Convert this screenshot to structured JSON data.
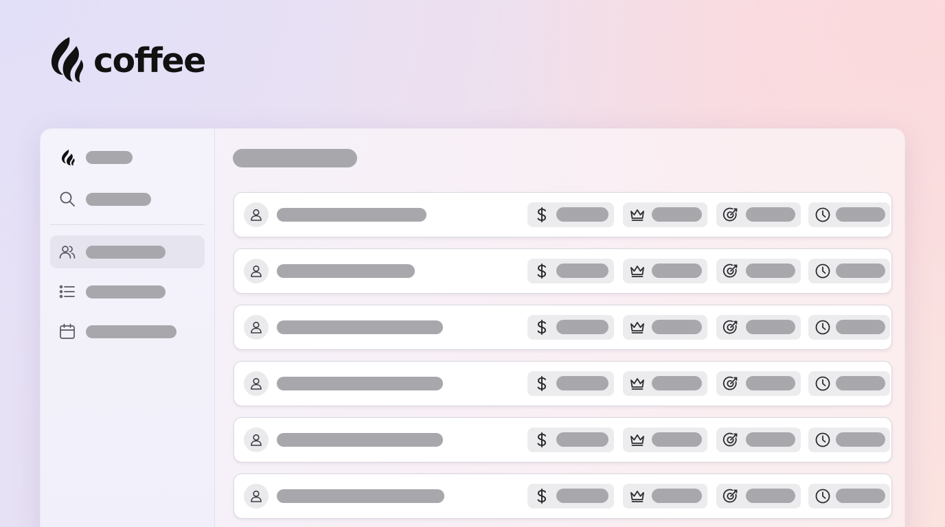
{
  "brand": {
    "name": "coffee",
    "logo_icon": "flame-logo-icon"
  },
  "sidebar": {
    "items": [
      {
        "icon": "flame-logo-icon",
        "label": "",
        "active": false
      },
      {
        "icon": "search-icon",
        "label": "",
        "active": false
      },
      {
        "icon": "users-icon",
        "label": "",
        "active": true
      },
      {
        "icon": "list-icon",
        "label": "",
        "active": false
      },
      {
        "icon": "calendar-icon",
        "label": "",
        "active": false
      }
    ]
  },
  "main": {
    "title": "",
    "rows": [
      {
        "avatar_icon": "user-icon",
        "name": "",
        "stats": [
          {
            "icon": "dollar-icon",
            "value": ""
          },
          {
            "icon": "crown-icon",
            "value": ""
          },
          {
            "icon": "target-icon",
            "value": ""
          },
          {
            "icon": "clock-icon",
            "value": ""
          }
        ]
      },
      {
        "avatar_icon": "user-icon",
        "name": "",
        "stats": [
          {
            "icon": "dollar-icon",
            "value": ""
          },
          {
            "icon": "crown-icon",
            "value": ""
          },
          {
            "icon": "target-icon",
            "value": ""
          },
          {
            "icon": "clock-icon",
            "value": ""
          }
        ]
      },
      {
        "avatar_icon": "user-icon",
        "name": "",
        "stats": [
          {
            "icon": "dollar-icon",
            "value": ""
          },
          {
            "icon": "crown-icon",
            "value": ""
          },
          {
            "icon": "target-icon",
            "value": ""
          },
          {
            "icon": "clock-icon",
            "value": ""
          }
        ]
      },
      {
        "avatar_icon": "user-icon",
        "name": "",
        "stats": [
          {
            "icon": "dollar-icon",
            "value": ""
          },
          {
            "icon": "crown-icon",
            "value": ""
          },
          {
            "icon": "target-icon",
            "value": ""
          },
          {
            "icon": "clock-icon",
            "value": ""
          }
        ]
      },
      {
        "avatar_icon": "user-icon",
        "name": "",
        "stats": [
          {
            "icon": "dollar-icon",
            "value": ""
          },
          {
            "icon": "crown-icon",
            "value": ""
          },
          {
            "icon": "target-icon",
            "value": ""
          },
          {
            "icon": "clock-icon",
            "value": ""
          }
        ]
      },
      {
        "avatar_icon": "user-icon",
        "name": "",
        "stats": [
          {
            "icon": "dollar-icon",
            "value": ""
          },
          {
            "icon": "crown-icon",
            "value": ""
          },
          {
            "icon": "target-icon",
            "value": ""
          },
          {
            "icon": "clock-icon",
            "value": ""
          }
        ]
      }
    ]
  },
  "colors": {
    "placeholder_bar": "#a8a8ac",
    "chip_background": "#ececee",
    "active_nav_background": "#e6e4ee",
    "text_primary": "#111111"
  }
}
